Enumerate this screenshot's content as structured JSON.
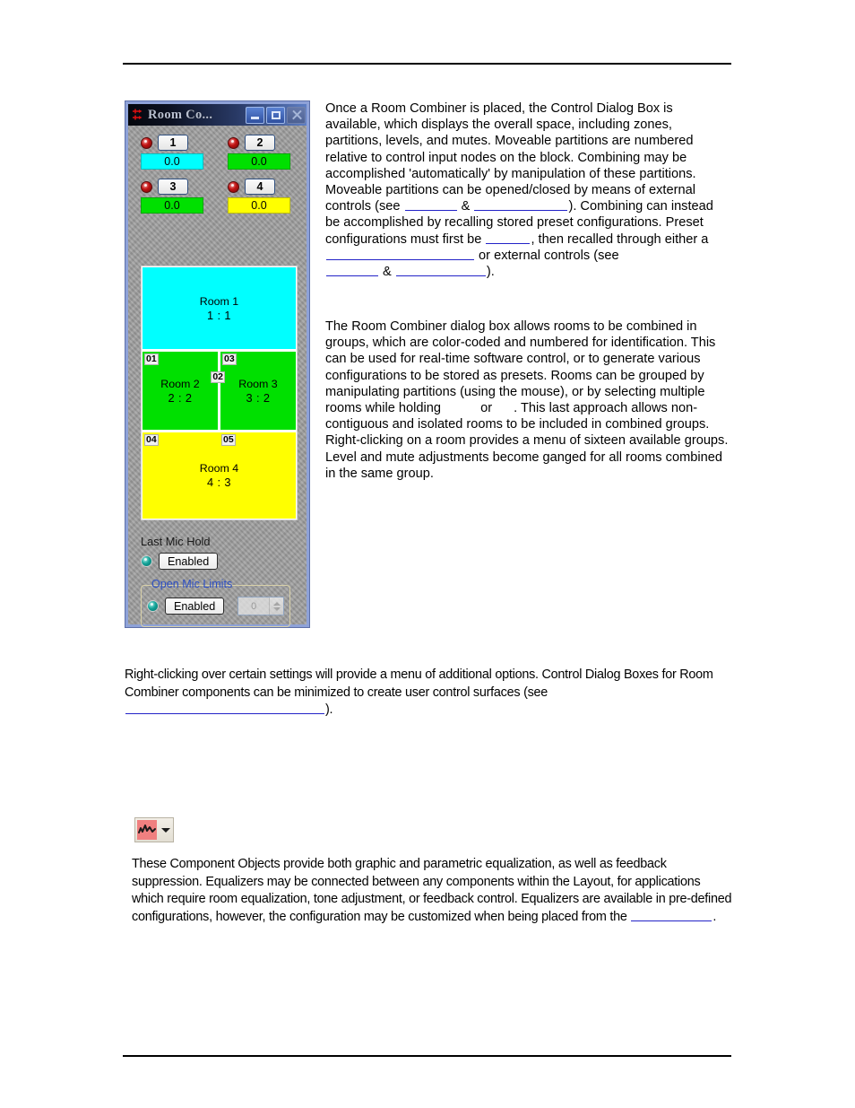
{
  "page": {
    "rules": {
      "top": "",
      "bottom": ""
    }
  },
  "dialog": {
    "title": "Room Co...",
    "icon": "room-combiner-icon",
    "window_buttons": [
      {
        "name": "minimize-button",
        "glyph": "minimize"
      },
      {
        "name": "maximize-button",
        "glyph": "maximize"
      },
      {
        "name": "close-button",
        "glyph": "close",
        "disabled": true
      }
    ],
    "zones": [
      {
        "number": "1",
        "level": "0.0",
        "level_color": "#00ffff",
        "mute": "muted"
      },
      {
        "number": "2",
        "level": "0.0",
        "level_color": "#00e000",
        "mute": "muted"
      },
      {
        "number": "3",
        "level": "0.0",
        "level_color": "#00e000",
        "mute": "muted"
      },
      {
        "number": "4",
        "level": "0.0",
        "level_color": "#ffff00",
        "mute": "muted"
      }
    ],
    "rooms": [
      {
        "label": "Room 1",
        "ratio": "1 : 1",
        "color": "#00ffff"
      },
      {
        "label": "Room 2",
        "ratio": "2 : 2",
        "color": "#00e000"
      },
      {
        "label": "Room 3",
        "ratio": "3 : 2",
        "color": "#00e000"
      },
      {
        "label": "Room 4",
        "ratio": "4 : 3",
        "color": "#ffff00"
      }
    ],
    "partitions": [
      "01",
      "02",
      "03",
      "04",
      "05"
    ],
    "last_mic_hold": {
      "label": "Last Mic Hold",
      "button_label": "Enabled"
    },
    "open_mic_limits": {
      "legend": "Open Mic Limits",
      "button_label": "Enabled",
      "spinner_value": "0"
    }
  },
  "toolbar": {
    "equalizer_button": "equalizer-dropdown-button"
  },
  "text": {
    "para_right_1_a": "Once a Room Combiner is placed, the Control Dialog Box is available, which displays the overall space, including zones, partitions, levels, and mutes. Moveable partitions are numbered relative to control input nodes on the block. Combining may be accomplished 'automatically' by manipulation of these partitions. Moveable partitions can be opened/closed by means of external controls (see ",
    "para_right_1_b": " & ",
    "para_right_1_c": "). Combining can instead be accomplished by recalling stored preset configurations. Preset configurations must first be ",
    "para_right_1_d": ", then recalled through either a ",
    "para_right_1_e": " or external controls (see ",
    "para_right_1_f": " & ",
    "para_right_1_g": ").",
    "para_right_2": "The Room Combiner dialog box allows rooms to be combined in groups, which are color-coded and numbered for identification. This can be used for real-time software control, or to generate various configurations to be stored as presets. Rooms can be grouped by manipulating partitions (using the mouse), or by selecting multiple rooms while holding ",
    "para_right_2_b": " or ",
    "para_right_2_c": ". This last approach allows non-contiguous and isolated rooms to be included in combined groups. Right-clicking on a room provides a menu of sixteen available groups. Level and mute adjustments become ganged for all rooms combined in the same group.",
    "para_mid_a": "Right-clicking over certain settings will provide a menu of additional options. Control Dialog Boxes for Room Combiner components can be minimized to create user control surfaces (see ",
    "para_mid_b": ").",
    "para_bottom_a": "These Component Objects provide both graphic and parametric equalization, as well as feedback suppression. Equalizers may be connected between any components within the Layout, for applications which require room equalization, tone adjustment, or feedback control. Equalizers are available in pre-defined configurations, however, the configuration may be customized when being placed from the ",
    "para_bottom_b": "."
  },
  "colors": {
    "link": "#2323c8",
    "dialog_chrome": "#8ea2d8",
    "dialog_face": "#9d9d9d",
    "legend_text": "#2d4fc4",
    "eq_icon": "#f08080"
  }
}
